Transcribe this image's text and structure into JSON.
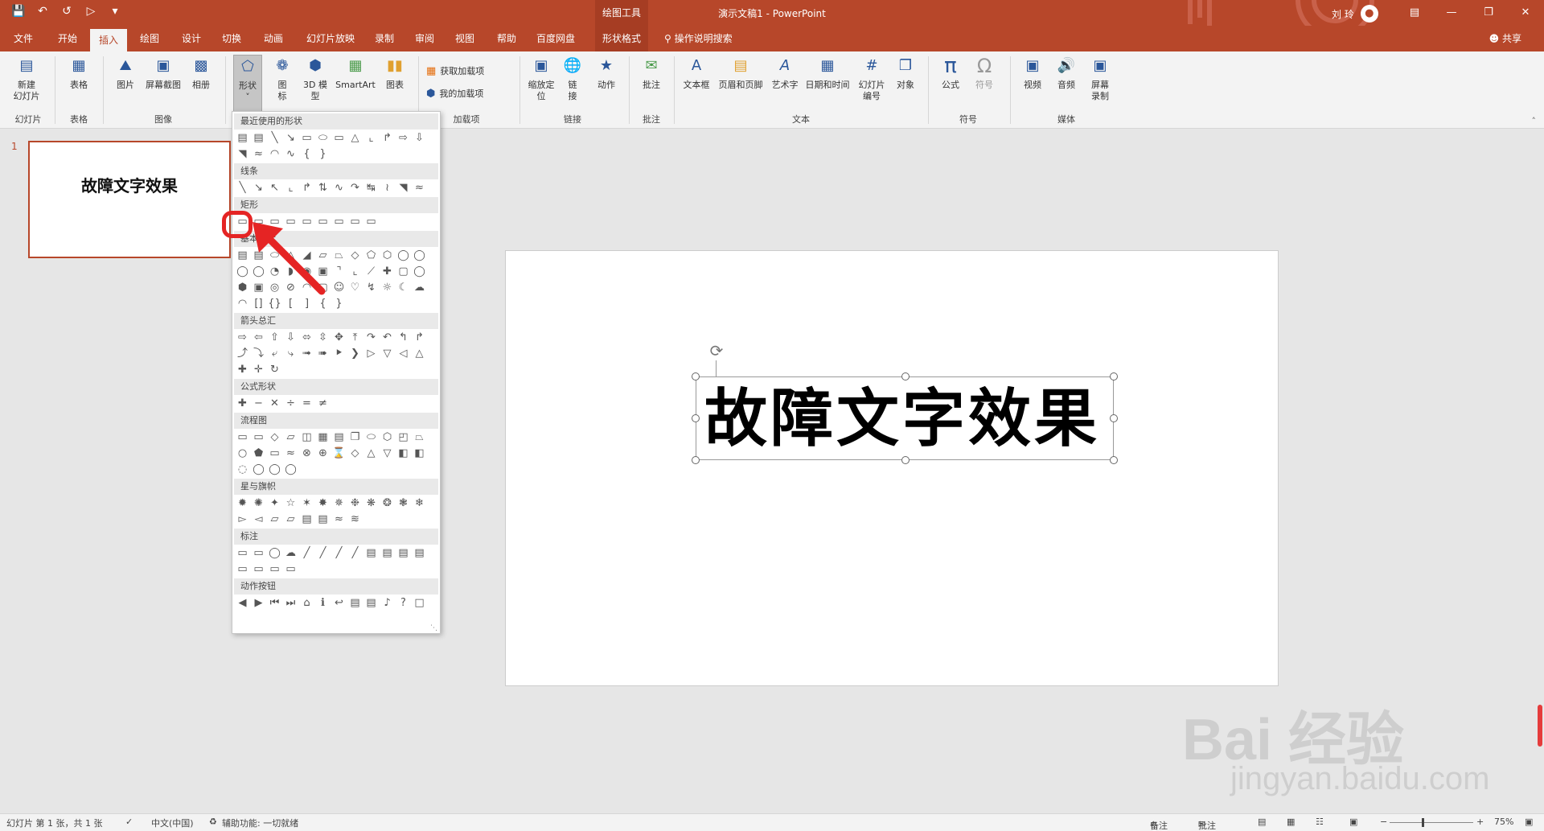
{
  "app": {
    "context_label": "绘图工具",
    "doc_title": "演示文稿1",
    "app_name": "PowerPoint",
    "user": "刘 玲",
    "accent": "#b7472a"
  },
  "qat": {
    "save": "save-icon",
    "undo": "undo-icon",
    "redo": "redo-icon",
    "present": "present-icon",
    "more": "more-icon"
  },
  "tabs": [
    "文件",
    "开始",
    "插入",
    "绘图",
    "设计",
    "切换",
    "动画",
    "幻灯片放映",
    "录制",
    "审阅",
    "视图",
    "帮助",
    "百度网盘",
    "形状格式"
  ],
  "active_tab": "插入",
  "search_label": "操作说明搜索",
  "share_label": "共享",
  "ribbon": {
    "new_slide": "新建\n幻灯片",
    "table": "表格",
    "picture": "图片",
    "screenshot": "屏幕截图",
    "album": "相册",
    "shapes": "形状",
    "icons": "图\n标",
    "model3d": "3D 模\n型",
    "smartart": "SmartArt",
    "chart": "图表",
    "get_addins": "获取加载项",
    "my_addins": "我的加载项",
    "zoom": "缩放定\n位",
    "link": "链\n接",
    "action": "动作",
    "comment": "批注",
    "textbox": "文本框",
    "header_footer": "页眉和页脚",
    "wordart": "艺术字",
    "datetime": "日期和时间",
    "slide_number": "幻灯片\n编号",
    "object": "对象",
    "equation": "公式",
    "symbol": "符号",
    "video": "视频",
    "audio": "音频",
    "screen_rec": "屏幕\n录制",
    "groups": {
      "slides": "幻灯片",
      "tables": "表格",
      "images": "图像",
      "addins": "加载项",
      "links": "链接",
      "comments": "批注",
      "text": "文本",
      "symbols": "符号",
      "media": "媒体"
    }
  },
  "thumbnail": {
    "number": "1",
    "text": "故障文字效果"
  },
  "slide": {
    "text": "故障文字效果"
  },
  "shapes_menu": {
    "sections": [
      "最近使用的形状",
      "线条",
      "矩形",
      "基本形状",
      "箭头总汇",
      "公式形状",
      "流程图",
      "星与旗帜",
      "标注",
      "动作按钮"
    ]
  },
  "watermark": {
    "brand": "Bai 经验",
    "url": "jingyan.baidu.com"
  },
  "status": {
    "slide_info": "幻灯片 第 1 张，共 1 张",
    "language": "中文(中国)",
    "accessibility": "辅助功能: 一切就绪",
    "notes": "备注",
    "comments": "批注",
    "zoom": "75%"
  }
}
